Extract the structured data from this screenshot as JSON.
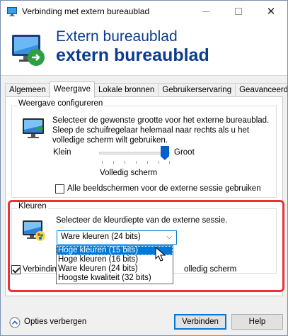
{
  "window": {
    "title": "Verbinding met extern bureaublad"
  },
  "banner": {
    "line1": "Extern bureaublad",
    "line2": "extern bureaublad"
  },
  "tabs": [
    {
      "label": "Algemeen"
    },
    {
      "label": "Weergave",
      "active": true
    },
    {
      "label": "Lokale bronnen"
    },
    {
      "label": "Gebruikerservaring"
    },
    {
      "label": "Geavanceerd"
    }
  ],
  "display_config": {
    "legend": "Weergave configureren",
    "description": [
      "Selecteer de gewenste grootte voor het externe bureaublad.",
      "Sleep de schuifregelaar helemaal naar rechts als u het",
      "volledige scherm wilt gebruiken."
    ],
    "slider_min_label": "Klein",
    "slider_max_label": "Groot",
    "slider_value_label": "Volledig scherm",
    "slider_level": 1.0,
    "all_monitors_label": "Alle beeldschermen voor de externe sessie gebruiken",
    "all_monitors_checked": false
  },
  "colors": {
    "legend": "Kleuren",
    "description": "Selecteer de kleurdiepte van de externe sessie.",
    "selected": "Ware kleuren (24 bits)",
    "options": [
      "Hoge kleuren (15 bits)",
      "Hoge kleuren (16 bits)",
      "Ware kleuren (24 bits)",
      "Hoogste kwaliteit (32 bits)"
    ],
    "hovered_index": 0
  },
  "connection_bar": {
    "left_text": "Verbinding",
    "right_text": "olledig scherm",
    "checked": true
  },
  "footer": {
    "options_label": "Opties verbergen",
    "connect_label": "Verbinden",
    "help_label": "Help"
  },
  "accent": "#0b3c8f",
  "highlight_color": "#e8323a"
}
